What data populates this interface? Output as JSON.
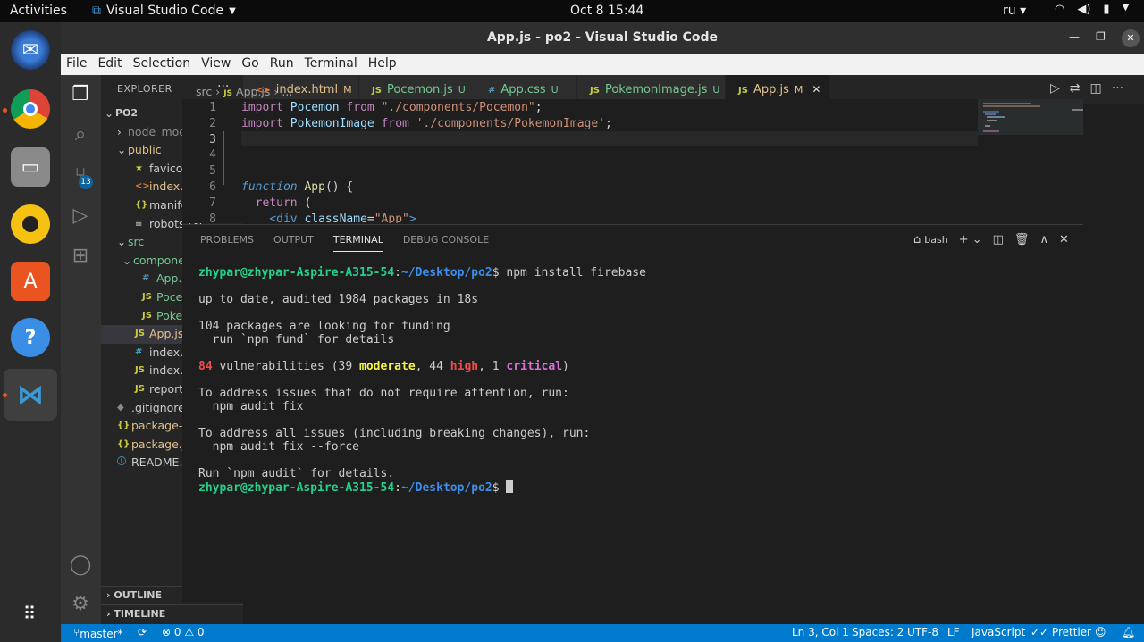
{
  "system": {
    "activities": "Activities",
    "app_name": "Visual Studio Code",
    "clock": "Oct 8  15:44",
    "lang": "ru"
  },
  "window": {
    "title": "App.js - po2 - Visual Studio Code",
    "close": "✕"
  },
  "menu": [
    "File",
    "Edit",
    "Selection",
    "View",
    "Go",
    "Run",
    "Terminal",
    "Help"
  ],
  "scm_badge": "13",
  "explorer": {
    "header": "EXPLORER",
    "more": "···",
    "tree": [
      {
        "name": "PO2",
        "chev": "⌄",
        "indent": 4,
        "cls": "",
        "bold": true
      },
      {
        "name": "node_modules",
        "chev": "›",
        "indent": 18,
        "cls": "gr"
      },
      {
        "name": "public",
        "chev": "⌄",
        "indent": 18,
        "cls": "y",
        "status": "●"
      },
      {
        "name": "favicon.ico",
        "icon": "★",
        "iconcls": "y",
        "indent": 38,
        "cls": ""
      },
      {
        "name": "index.html",
        "icon": "<>",
        "iconcls": "or",
        "indent": 38,
        "cls": "y",
        "status": "M"
      },
      {
        "name": "manifest.json",
        "icon": "{}",
        "iconcls": "y",
        "indent": 38,
        "cls": ""
      },
      {
        "name": "robots.txt",
        "icon": "≡",
        "iconcls": "",
        "indent": 38,
        "cls": ""
      },
      {
        "name": "src",
        "chev": "⌄",
        "indent": 18,
        "cls": "g",
        "status": "●"
      },
      {
        "name": "components",
        "chev": "⌄",
        "indent": 24,
        "cls": "g",
        "status": "●"
      },
      {
        "name": "App.css",
        "icon": "#",
        "iconcls": "bl",
        "indent": 46,
        "cls": "g",
        "status": "U"
      },
      {
        "name": "Pocemon.js",
        "icon": "JS",
        "iconcls": "y",
        "indent": 46,
        "cls": "g",
        "status": "U"
      },
      {
        "name": "PokemonIma...",
        "icon": "JS",
        "iconcls": "y",
        "indent": 46,
        "cls": "g",
        "status": "U"
      },
      {
        "name": "App.js",
        "icon": "JS",
        "iconcls": "y",
        "indent": 38,
        "cls": "y",
        "status": "M",
        "selected": true
      },
      {
        "name": "index.css",
        "icon": "#",
        "iconcls": "bl",
        "indent": 38,
        "cls": ""
      },
      {
        "name": "index.js",
        "icon": "JS",
        "iconcls": "y",
        "indent": 38,
        "cls": ""
      },
      {
        "name": "reportWebVitals.js",
        "icon": "JS",
        "iconcls": "y",
        "indent": 38,
        "cls": ""
      },
      {
        "name": ".gitignore",
        "icon": "◆",
        "iconcls": "gr",
        "indent": 18,
        "cls": ""
      },
      {
        "name": "package-lock.json",
        "icon": "{}",
        "iconcls": "y",
        "indent": 18,
        "cls": "y",
        "status": "M"
      },
      {
        "name": "package.json",
        "icon": "{}",
        "iconcls": "y",
        "indent": 18,
        "cls": "y",
        "status": "M"
      },
      {
        "name": "README.md",
        "icon": "ⓘ",
        "iconcls": "bl",
        "indent": 18,
        "cls": ""
      }
    ],
    "outline": "OUTLINE",
    "timeline": "TIMELINE"
  },
  "tabs": [
    {
      "label": "index.html",
      "icon": "<>",
      "status": "M",
      "iconColor": "#e37933",
      "textColor": "#e2c08d"
    },
    {
      "label": "Pocemon.js",
      "icon": "JS",
      "status": "U",
      "iconColor": "#cbcb41",
      "textColor": "#73c991"
    },
    {
      "label": "App.css",
      "icon": "#",
      "status": "U",
      "iconColor": "#519aba",
      "textColor": "#73c991"
    },
    {
      "label": "PokemonImage.js",
      "icon": "JS",
      "status": "U",
      "iconColor": "#cbcb41",
      "textColor": "#73c991"
    },
    {
      "label": "App.js",
      "icon": "JS",
      "status": "M",
      "iconColor": "#cbcb41",
      "textColor": "#e2c08d",
      "active": true,
      "close": "✕"
    }
  ],
  "breadcrumb": {
    "folder": "src",
    "file": "App.js",
    "more": "..."
  },
  "code": {
    "line_numbers": [
      "1",
      "2",
      "3",
      "4",
      "5",
      "6",
      "7",
      "8"
    ]
  },
  "panel": {
    "tabs": [
      "PROBLEMS",
      "OUTPUT",
      "TERMINAL",
      "DEBUG CONSOLE"
    ],
    "active": "TERMINAL",
    "shell": "bash"
  },
  "terminal": {
    "prompt_user": "zhypar@zhypar-Aspire-A315-54",
    "prompt_path": "~/Desktop/po2",
    "command": "npm install firebase",
    "lines": [
      "up to date, audited 1984 packages in 18s",
      "104 packages are looking for funding",
      "  run `npm fund` for details",
      "To address issues that do not require attention, run:",
      "  npm audit fix",
      "To address all issues (including breaking changes), run:",
      "  npm audit fix --force",
      "Run `npm audit` for details."
    ],
    "vuln_count": "84",
    "vuln_word": "vulnerabilities (39",
    "moderate": "moderate",
    "high_count": ", 44",
    "high": "high",
    "crit_count": ", 1",
    "critical": "critical"
  },
  "status": {
    "branch": "master*",
    "problems": "⊗ 0 ⚠ 0",
    "position": "Ln 3, Col 1",
    "spaces": "Spaces: 2",
    "encoding": "UTF-8",
    "eol": "LF",
    "language": "JavaScript",
    "prettier": "✓✓ Prettier"
  }
}
